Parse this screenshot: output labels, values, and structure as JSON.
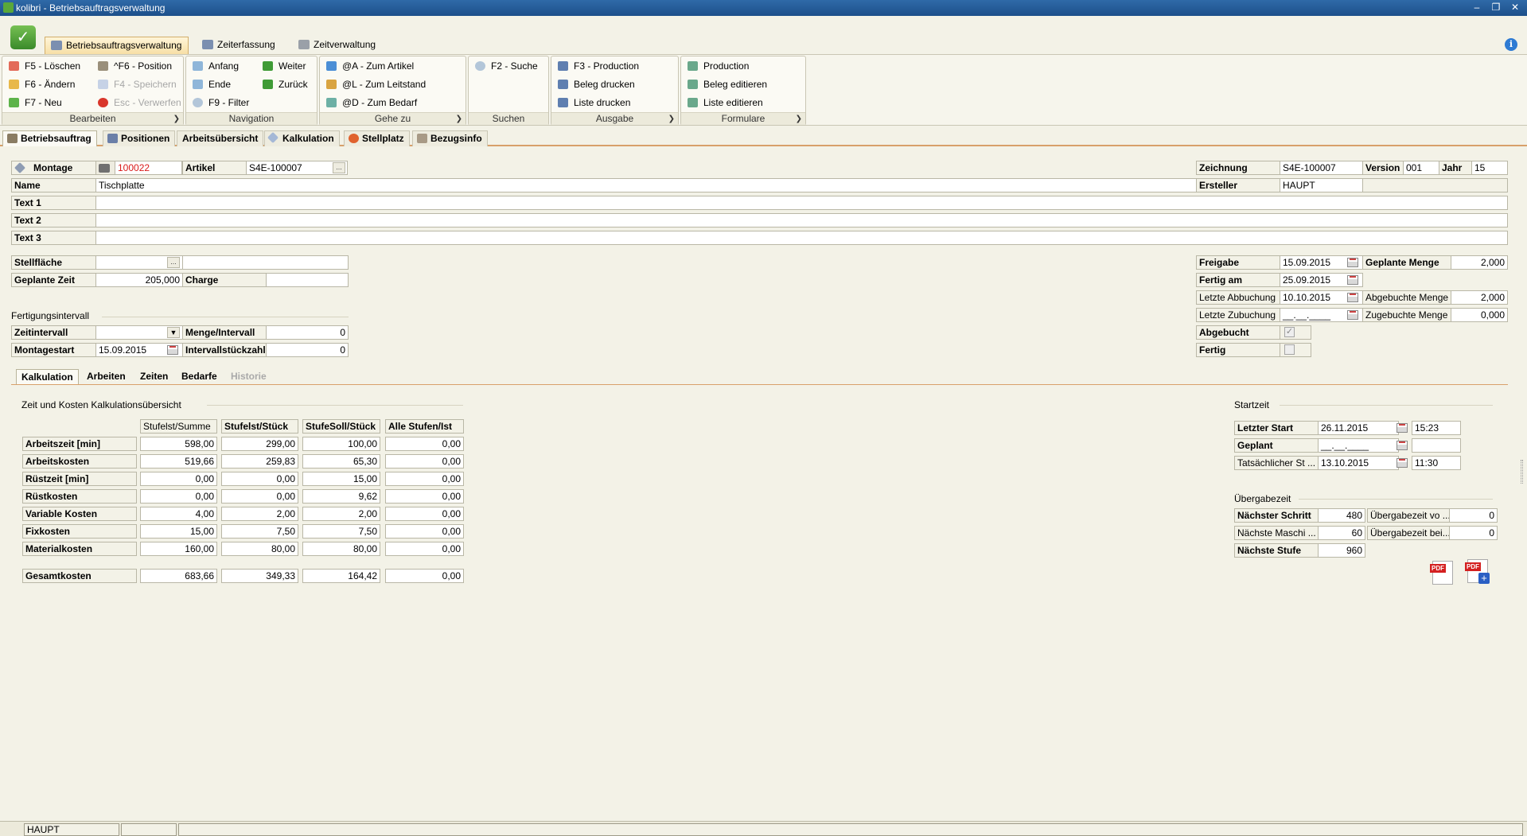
{
  "window": {
    "title": "kolibri - Betriebsauftragsverwaltung"
  },
  "ribbon_tabs": [
    "Betriebsauftragsverwaltung",
    "Zeiterfassung",
    "Zeitverwaltung"
  ],
  "groups": {
    "bearbeiten": {
      "label": "Bearbeiten",
      "items": [
        "F5 - Löschen",
        "F6 - Ändern",
        "F7 - Neu",
        "^F6 - Position",
        "F4 - Speichern",
        "Esc - Verwerfen"
      ]
    },
    "navigation": {
      "label": "Navigation",
      "items": [
        "Anfang",
        "Ende",
        "F9 - Filter",
        "Weiter",
        "Zurück"
      ]
    },
    "gehezu": {
      "label": "Gehe zu",
      "items": [
        "@A - Zum Artikel",
        "@L - Zum Leitstand",
        "@D - Zum Bedarf"
      ]
    },
    "suchen": {
      "label": "Suchen",
      "items": [
        "F2 - Suche"
      ]
    },
    "ausgabe": {
      "label": "Ausgabe",
      "items": [
        "F3 - Production",
        "Beleg drucken",
        "Liste drucken"
      ]
    },
    "formulare": {
      "label": "Formulare",
      "items": [
        "Production",
        "Beleg editieren",
        "Liste editieren"
      ]
    }
  },
  "main_tabs": [
    "Betriebsauftrag",
    "Positionen",
    "Arbeitsübersicht",
    "Kalkulation",
    "Stellplatz",
    "Bezugsinfo"
  ],
  "header": {
    "montage_label": "Montage",
    "montage_value": "100022",
    "artikel_label": "Artikel",
    "artikel_value": "S4E-100007",
    "name_label": "Name",
    "name_value": "Tischplatte",
    "text1_label": "Text 1",
    "text2_label": "Text 2",
    "text3_label": "Text 3",
    "zeichnung_label": "Zeichnung",
    "zeichnung_value": "S4E-100007",
    "version_label": "Version",
    "version_value": "001",
    "jahr_label": "Jahr",
    "jahr_value": "15",
    "ersteller_label": "Ersteller",
    "ersteller_value": "HAUPT"
  },
  "left_form": {
    "stellflaeche_label": "Stellfläche",
    "geplante_zeit_label": "Geplante Zeit",
    "geplante_zeit_value": "205,000",
    "charge_label": "Charge",
    "fertigungsintervall_label": "Fertigungsintervall",
    "zeitintervall_label": "Zeitintervall",
    "menge_intervall_label": "Menge/Intervall",
    "menge_intervall_value": "0",
    "montagestart_label": "Montagestart",
    "montagestart_value": "15.09.2015",
    "intervallstueckzahl_label": "Intervallstückzahl",
    "intervallstueckzahl_value": "0"
  },
  "right_form": {
    "freigabe_label": "Freigabe",
    "freigabe_value": "15.09.2015",
    "geplante_menge_label": "Geplante Menge",
    "geplante_menge_value": "2,000",
    "fertig_am_label": "Fertig am",
    "fertig_am_value": "25.09.2015",
    "letzte_abbuchung_label": "Letzte Abbuchung",
    "letzte_abbuchung_value": "10.10.2015",
    "abgebuchte_menge_label": "Abgebuchte Menge",
    "abgebuchte_menge_value": "2,000",
    "letzte_zubuchung_label": "Letzte Zubuchung",
    "letzte_zubuchung_value": "__.__.____",
    "zugebuchte_menge_label": "Zugebuchte Menge",
    "zugebuchte_menge_value": "0,000",
    "abgebucht_label": "Abgebucht",
    "abgebucht_checked": true,
    "fertig_label": "Fertig",
    "fertig_checked": false
  },
  "sub_tabs": [
    "Kalkulation",
    "Arbeiten",
    "Zeiten",
    "Bedarfe",
    "Historie"
  ],
  "kalkulation": {
    "title": "Zeit und Kosten Kalkulationsübersicht",
    "columns": [
      "Stufelst/Summe",
      "Stufelst/Stück",
      "StufeSoll/Stück",
      "Alle Stufen/Ist"
    ],
    "rows": [
      {
        "label": "Arbeitszeit [min]",
        "values": [
          "598,00",
          "299,00",
          "100,00",
          "0,00"
        ]
      },
      {
        "label": "Arbeitskosten",
        "values": [
          "519,66",
          "259,83",
          "65,30",
          "0,00"
        ]
      },
      {
        "label": "Rüstzeit [min]",
        "values": [
          "0,00",
          "0,00",
          "15,00",
          "0,00"
        ]
      },
      {
        "label": "Rüstkosten",
        "values": [
          "0,00",
          "0,00",
          "9,62",
          "0,00"
        ]
      },
      {
        "label": "Variable Kosten",
        "values": [
          "4,00",
          "2,00",
          "2,00",
          "0,00"
        ]
      },
      {
        "label": "Fixkosten",
        "values": [
          "15,00",
          "7,50",
          "7,50",
          "0,00"
        ]
      },
      {
        "label": "Materialkosten",
        "values": [
          "160,00",
          "80,00",
          "80,00",
          "0,00"
        ]
      }
    ],
    "total": {
      "label": "Gesamtkosten",
      "values": [
        "683,66",
        "349,33",
        "164,42",
        "0,00"
      ]
    }
  },
  "startzeit": {
    "title": "Startzeit",
    "rows": [
      {
        "label": "Letzter Start",
        "date": "26.11.2015",
        "time": "15:23",
        "bold": true
      },
      {
        "label": "Geplant",
        "date": "__.__.____",
        "time": "",
        "bold": true
      },
      {
        "label": "Tatsächlicher St ...",
        "date": "13.10.2015",
        "time": "11:30",
        "bold": false
      }
    ]
  },
  "uebergabezeit": {
    "title": "Übergabezeit",
    "naechster_schritt_label": "Nächster Schritt",
    "naechster_schritt_value": "480",
    "uebergabe_vo_label": "Übergabezeit vo ...",
    "uebergabe_vo_value": "0",
    "naechste_maschi_label": "Nächste Maschi ...",
    "naechste_maschi_value": "60",
    "uebergabe_bei_label": "Übergabezeit bei...",
    "uebergabe_bei_value": "0",
    "naechste_stufe_label": "Nächste Stufe",
    "naechste_stufe_value": "960"
  },
  "status": {
    "user": "HAUPT"
  },
  "icons": {
    "pdf": "pdf-icon",
    "pdf_add": "pdf-add-icon"
  }
}
